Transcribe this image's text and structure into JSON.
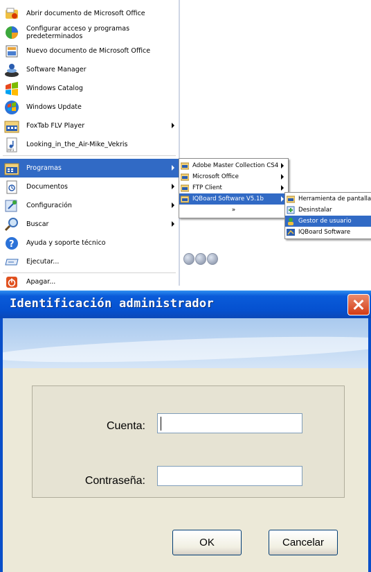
{
  "start_menu": {
    "items": [
      {
        "label": "Abrir documento de Microsoft Office",
        "icon": "office-open-icon"
      },
      {
        "label": "Configurar acceso y programas predeterminados",
        "icon": "program-access-icon"
      },
      {
        "label": "Nuevo documento de Microsoft Office",
        "icon": "office-new-icon"
      },
      {
        "label": "Software Manager",
        "icon": "software-manager-icon"
      },
      {
        "label": "Windows Catalog",
        "icon": "windows-catalog-icon"
      },
      {
        "label": "Windows Update",
        "icon": "windows-update-icon"
      },
      {
        "label": "FoxTab FLV Player",
        "icon": "foxtab-icon"
      },
      {
        "label": "Looking_in_the_Air-Mike_Vekris",
        "icon": "mp3-file-icon"
      },
      {
        "label": "Programas",
        "icon": "programs-icon"
      },
      {
        "label": "Documentos",
        "icon": "documents-icon"
      },
      {
        "label": "Configuración",
        "icon": "settings-icon"
      },
      {
        "label": "Buscar",
        "icon": "search-icon"
      },
      {
        "label": "Ayuda y soporte técnico",
        "icon": "help-icon"
      },
      {
        "label": "Ejecutar...",
        "icon": "run-icon"
      },
      {
        "label": "Apagar...",
        "icon": "shutdown-icon"
      }
    ],
    "programs_submenu": [
      {
        "label": "Adobe Master Collection CS4"
      },
      {
        "label": "Microsoft Office"
      },
      {
        "label": "FTP Client"
      },
      {
        "label": "IQBoard Software V5.1b"
      },
      {
        "label": "»"
      }
    ],
    "iqboard_submenu": [
      {
        "label": "Herramienta de pantalla"
      },
      {
        "label": "Desinstalar"
      },
      {
        "label": "Gestor de usuario"
      },
      {
        "label": "IQBoard Software"
      }
    ]
  },
  "dialog": {
    "title": "Identificación administrador",
    "account_label": "Cuenta:",
    "account_value": "",
    "password_label": "Contraseña:",
    "password_value": "",
    "ok_label": "OK",
    "cancel_label": "Cancelar"
  },
  "colors": {
    "selection": "#316ac5",
    "titlebar": "#0551d0",
    "dialog_bg": "#ece9d8",
    "close_button": "#d43b14"
  }
}
